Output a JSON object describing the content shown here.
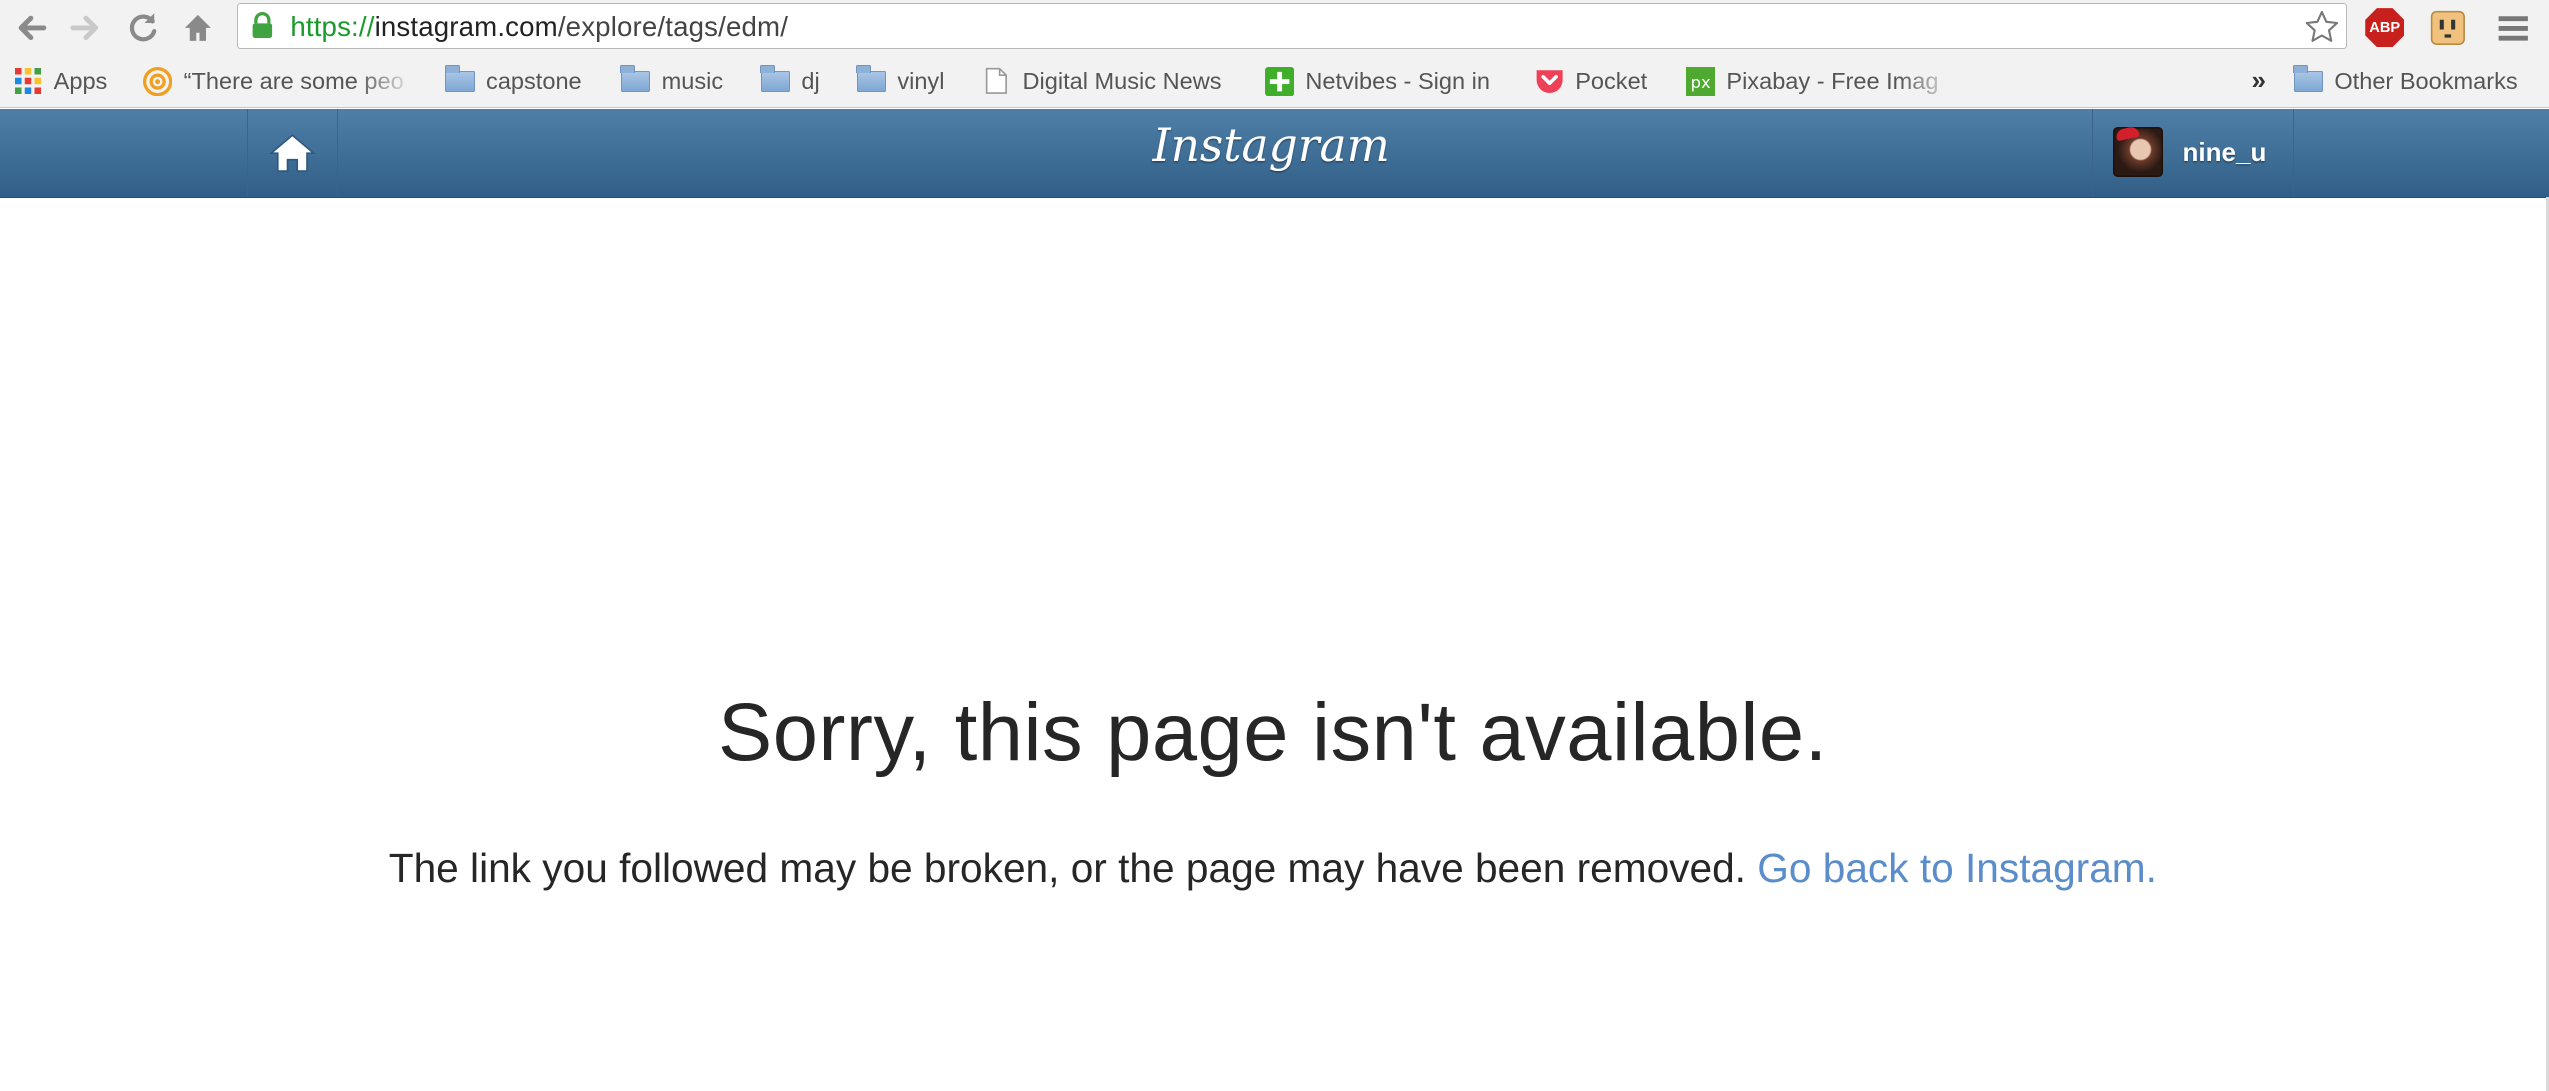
{
  "browser": {
    "url_scheme": "https://",
    "url_host": "instagram.com",
    "url_path": "/explore/tags/edm/",
    "extensions": [
      {
        "name": "adblock-plus",
        "label": "ABP"
      }
    ]
  },
  "bookmarks": {
    "items": [
      {
        "label": "Apps",
        "icon": "apps-grid-icon"
      },
      {
        "label": "“There are some peo",
        "icon": "target-icon"
      },
      {
        "label": "capstone",
        "icon": "folder-icon"
      },
      {
        "label": "music",
        "icon": "folder-icon"
      },
      {
        "label": "dj",
        "icon": "folder-icon"
      },
      {
        "label": "vinyl",
        "icon": "folder-icon"
      },
      {
        "label": "Digital Music News",
        "icon": "page-icon"
      },
      {
        "label": "Netvibes - Sign in",
        "icon": "netvibes-icon"
      },
      {
        "label": "Pocket",
        "icon": "pocket-icon"
      },
      {
        "label": "Pixabay - Free Imag",
        "icon": "pixabay-icon"
      }
    ],
    "overflow": "»",
    "other": "Other Bookmarks"
  },
  "instagram": {
    "logo": "Instagram",
    "username": "nine_u"
  },
  "error": {
    "title": "Sorry, this page isn't available.",
    "message": "The link you followed may be broken, or the page may have been removed.",
    "link": "Go back to Instagram."
  },
  "colors": {
    "header": "#3e6d95",
    "link": "#5b8dcb",
    "text": "#262626"
  }
}
